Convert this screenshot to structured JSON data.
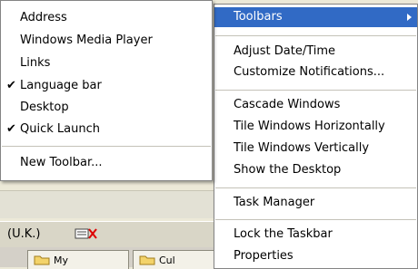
{
  "toolbars_submenu": {
    "items": [
      {
        "label": "Address",
        "checked": false
      },
      {
        "label": "Windows Media Player",
        "checked": false
      },
      {
        "label": "Links",
        "checked": false
      },
      {
        "label": "Language bar",
        "checked": true
      },
      {
        "label": "Desktop",
        "checked": false
      },
      {
        "label": "Quick Launch",
        "checked": true
      }
    ],
    "new_toolbar": "New Toolbar..."
  },
  "context_menu": {
    "toolbars": "Toolbars",
    "adjust_date_time": "Adjust Date/Time",
    "customize_notifications": "Customize Notifications...",
    "cascade_windows": "Cascade Windows",
    "tile_horizontally": "Tile Windows Horizontally",
    "tile_vertically": "Tile Windows Vertically",
    "show_desktop": "Show the Desktop",
    "task_manager": "Task Manager",
    "lock_taskbar": "Lock the Taskbar",
    "properties": "Properties"
  },
  "taskbar": {
    "language_indicator": "(U.K.)",
    "buttons": [
      "My",
      "Cul"
    ]
  },
  "colors": {
    "highlight": "#316ac5",
    "menu_bg": "#ffffff"
  }
}
